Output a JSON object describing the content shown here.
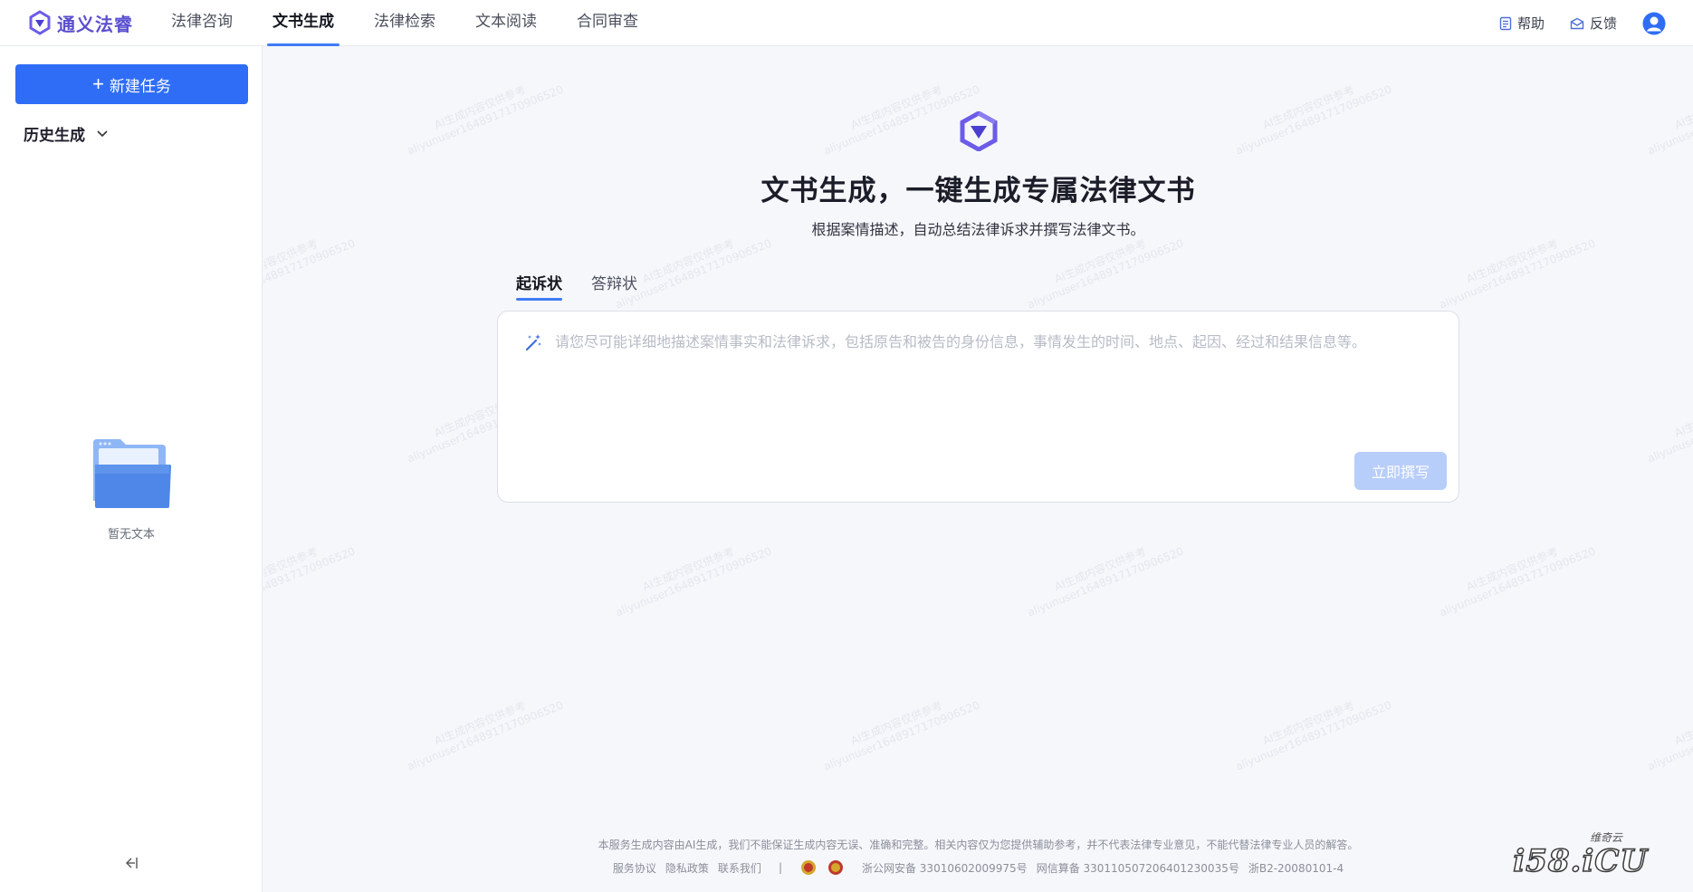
{
  "app": {
    "brand_name": "通义法睿",
    "logo_icon": "tongyi-logo-icon",
    "accent_color": "#2f6df6",
    "brand_color": "#5a4fcf"
  },
  "nav": {
    "tabs": [
      {
        "label": "法律咨询",
        "active": false
      },
      {
        "label": "文书生成",
        "active": true
      },
      {
        "label": "法律检索",
        "active": false
      },
      {
        "label": "文本阅读",
        "active": false
      },
      {
        "label": "合同审查",
        "active": false
      }
    ]
  },
  "top_actions": {
    "help_label": "帮助",
    "feedback_label": "反馈",
    "help_icon": "document-icon",
    "feedback_icon": "mail-icon",
    "avatar_icon": "user-avatar-icon"
  },
  "sidebar": {
    "new_task_label": "新建任务",
    "history_label": "历史生成",
    "empty_text": "暂无文本",
    "collapse_icon": "collapse-left-icon"
  },
  "main": {
    "title": "文书生成，一键生成专属法律文书",
    "subtitle": "根据案情描述，自动总结法律诉求并撰写法律文书。",
    "doc_tabs": [
      {
        "label": "起诉状",
        "active": true
      },
      {
        "label": "答辩状",
        "active": false
      }
    ],
    "editor_placeholder": "请您尽可能详细地描述案情事实和法律诉求，包括原告和被告的身份信息，事情发生的时间、地点、起因、经过和结果信息等。",
    "editor_icon": "magic-wand-icon",
    "submit_label": "立即撰写",
    "watermark_line1": "AI生成内容仅供参考",
    "watermark_line2": "aliyunuser1648917170906520"
  },
  "footer": {
    "disclaimer": "本服务生成内容由AI生成，我们不能保证生成内容无误、准确和完整。相关内容仅为您提供辅助参考，并不代表法律专业意见，不能代替法律专业人员的解答。",
    "service_agreement": "服务协议",
    "privacy_policy": "隐私政策",
    "contact_us": "联系我们",
    "separator": "|",
    "police_record": "浙公网安备 33010602009975号",
    "algorithm_record": "网信算备 330110507206401230035号",
    "icp_record": "浙B2-20080101-4"
  },
  "corner_watermark": {
    "text": "i58.iCU",
    "small_text": "维奇云"
  }
}
